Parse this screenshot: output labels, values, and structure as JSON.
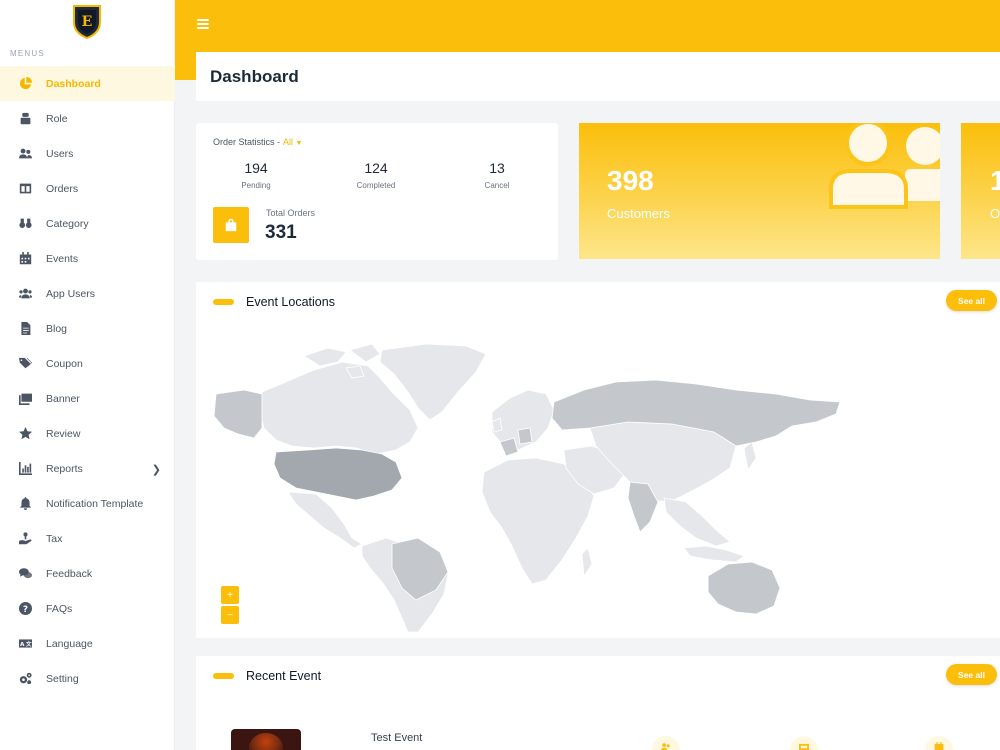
{
  "sidebar": {
    "logo_letter": "E",
    "menus_label": "MENUS",
    "items": [
      {
        "label": "Dashboard",
        "icon": "chart-pie-icon",
        "active": true
      },
      {
        "label": "Role",
        "icon": "role-icon"
      },
      {
        "label": "Users",
        "icon": "users-icon"
      },
      {
        "label": "Orders",
        "icon": "orders-icon"
      },
      {
        "label": "Category",
        "icon": "category-icon"
      },
      {
        "label": "Events",
        "icon": "calendar-icon"
      },
      {
        "label": "App Users",
        "icon": "app-users-icon"
      },
      {
        "label": "Blog",
        "icon": "blog-icon"
      },
      {
        "label": "Coupon",
        "icon": "coupon-icon"
      },
      {
        "label": "Banner",
        "icon": "banner-icon"
      },
      {
        "label": "Review",
        "icon": "star-icon"
      },
      {
        "label": "Reports",
        "icon": "reports-icon",
        "has_submenu": true
      },
      {
        "label": "Notification Template",
        "icon": "bell-icon"
      },
      {
        "label": "Tax",
        "icon": "tax-icon"
      },
      {
        "label": "Feedback",
        "icon": "feedback-icon"
      },
      {
        "label": "FAQs",
        "icon": "question-icon"
      },
      {
        "label": "Language",
        "icon": "language-icon"
      },
      {
        "label": "Setting",
        "icon": "gear-icon"
      }
    ]
  },
  "header": {
    "title": "Dashboard"
  },
  "order_stats": {
    "heading": "Order Statistics -",
    "filter": "All",
    "pending": {
      "value": "194",
      "label": "Pending"
    },
    "completed": {
      "value": "124",
      "label": "Completed"
    },
    "cancel": {
      "value": "13",
      "label": "Cancel"
    },
    "total_label": "Total Orders",
    "total_value": "331"
  },
  "customers": {
    "value": "398",
    "label": "Customers"
  },
  "next_card": {
    "value": "1",
    "label": "O"
  },
  "event_locations": {
    "title": "Event Locations",
    "see_all": "See all",
    "zoom_in": "+",
    "zoom_out": "−"
  },
  "recent_event": {
    "title": "Recent Event",
    "see_all": "See all",
    "event_name": "Test Event"
  },
  "colors": {
    "accent": "#fbbf0b",
    "map_land": "#e5e7eb",
    "map_highlight": "#c4c8cd",
    "map_dark": "#a3a8ae"
  }
}
